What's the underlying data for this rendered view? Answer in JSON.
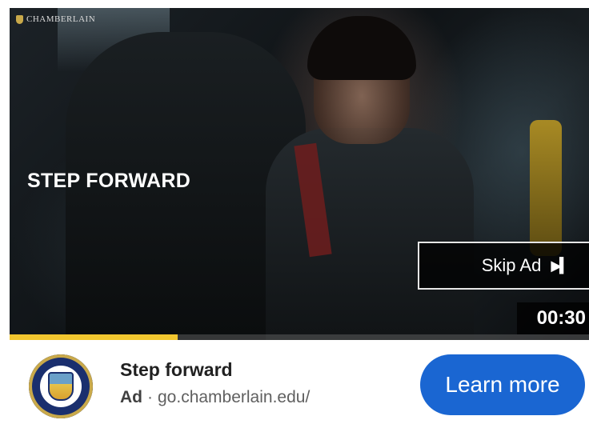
{
  "video": {
    "logo_text": "CHAMBERLAIN",
    "headline": "STEP FORWARD",
    "skip_label": "Skip Ad",
    "skip_icon": "skip-next-icon",
    "timer": "00:30",
    "progress": 0.29,
    "progress_color": "#f2c62f"
  },
  "ad": {
    "title": "Step forward",
    "label": "Ad",
    "separator": "·",
    "url": "go.chamberlain.edu/",
    "cta_label": "Learn more",
    "cta_color": "#1a66d2",
    "logo_icon": "chamberlain-seal-icon"
  }
}
